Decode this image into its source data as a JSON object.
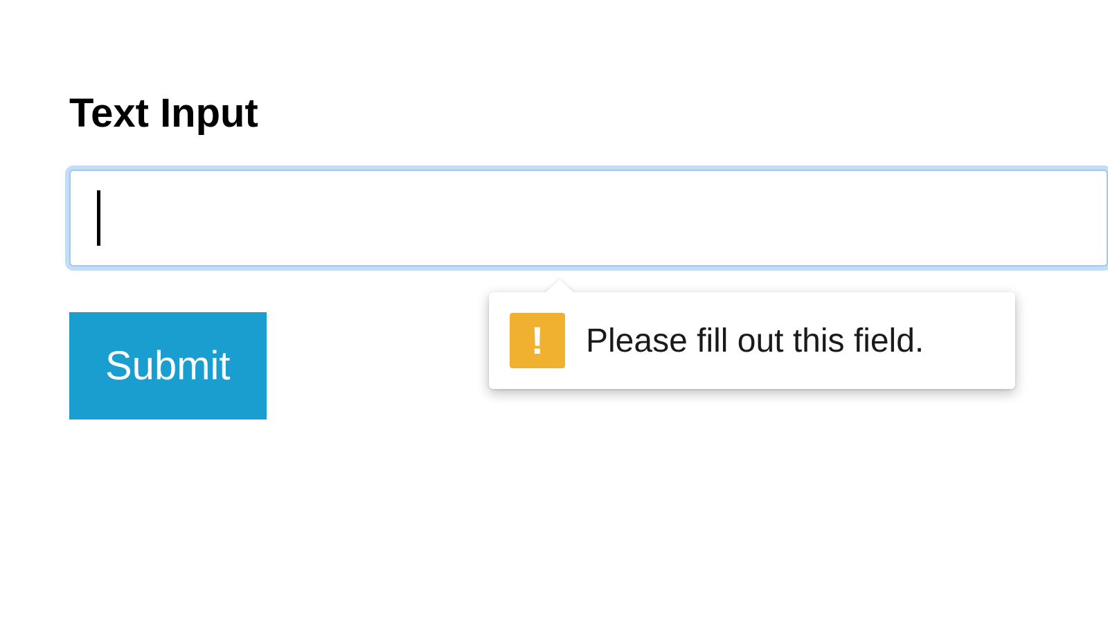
{
  "form": {
    "label": "Text Input",
    "input_value": "",
    "submit_label": "Submit"
  },
  "validation": {
    "message": "Please fill out this field.",
    "icon_glyph": "!"
  }
}
